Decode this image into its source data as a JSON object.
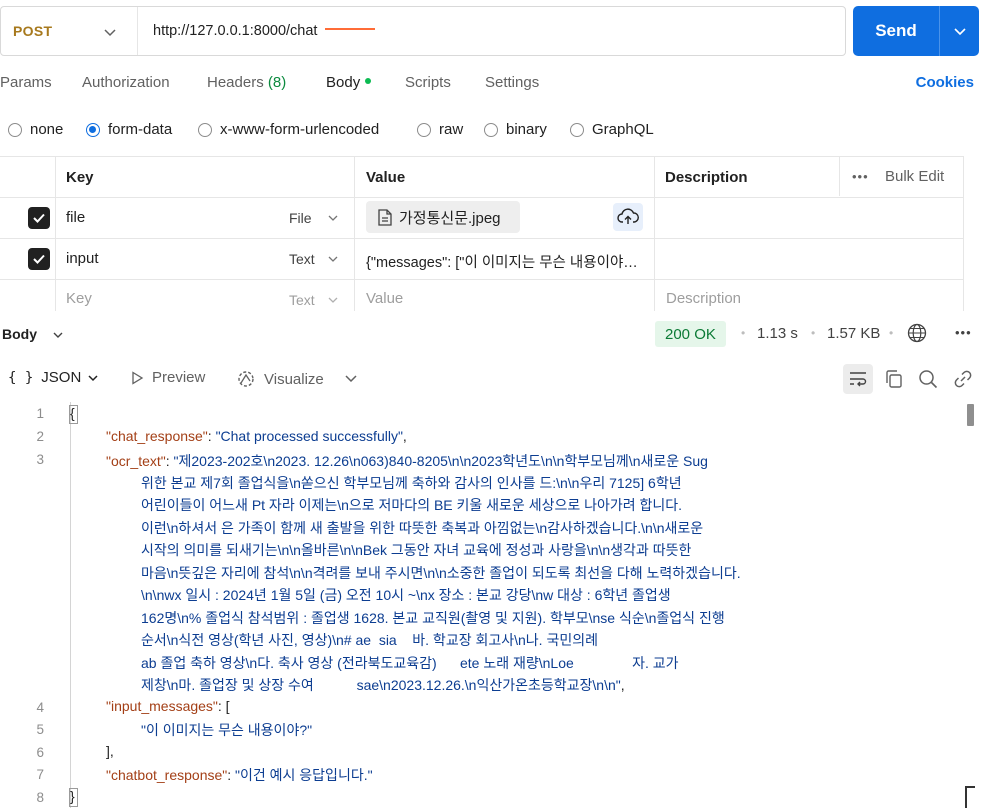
{
  "request": {
    "method": "POST",
    "url": "http://127.0.0.1:8000/chat",
    "send_label": "Send"
  },
  "tabs": {
    "params": "Params",
    "authorization": "Authorization",
    "headers": "Headers",
    "headers_count": "(8)",
    "body": "Body",
    "scripts": "Scripts",
    "settings": "Settings",
    "cookies": "Cookies"
  },
  "body_types": {
    "none": "none",
    "form_data": "form-data",
    "urlencoded": "x-www-form-urlencoded",
    "raw": "raw",
    "binary": "binary",
    "graphql": "GraphQL",
    "selected": "form-data"
  },
  "table": {
    "headers": {
      "key": "Key",
      "value": "Value",
      "description": "Description",
      "bulk_edit": "Bulk Edit"
    },
    "rows": [
      {
        "key": "file",
        "type": "File",
        "value": "가정통신문.jpeg",
        "checked": true
      },
      {
        "key": "input",
        "type": "Text",
        "value": "{\"messages\": [\"이 이미지는 무슨 내용이야?\"]}",
        "checked": true
      }
    ],
    "placeholder": {
      "key": "Key",
      "type": "Text",
      "value": "Value",
      "description": "Description"
    }
  },
  "response": {
    "section_label": "Body",
    "status": "200 OK",
    "time": "1.13 s",
    "size": "1.57 KB",
    "format": "JSON",
    "preview": "Preview",
    "visualize": "Visualize"
  },
  "code": {
    "line_numbers": [
      "1",
      "2",
      "3",
      "4",
      "5",
      "6",
      "7",
      "8"
    ],
    "open_brace": "{",
    "close_brace": "}",
    "chat_response_key": "\"chat_response\"",
    "chat_response_value": "\"Chat processed successfully\"",
    "ocr_text_key": "\"ocr_text\"",
    "ocr_text_lines": [
      "\"제2023-202호\\n2023. 12.26\\n063)840-8205\\n\\n2023학년도\\n\\n학부모님께\\n새로운 Sug",
      "위한 본교 제7회 졸업식을\\n쏟으신 학부모님께 축하와 감사의 인사를 드:\\n\\n우리 7125] 6학년",
      "어린이들이 어느새 Pt 자라 이제는\\n으로 저마다의 BE 키울 새로운 세상으로 나아가려 합니다.",
      "이런\\n하셔서 은 가족이 함께 새 출발을 위한 따뜻한 축복과 아낌없는\\n감사하겠습니다.\\n\\n새로운",
      "시작의 의미를 되새기는\\n\\n올바른\\n\\nBek 그동안 자녀 교육에 정성과 사랑을\\n\\n생각과 따뜻한",
      "마음\\n뜻깊은 자리에 참석\\n\\n격려를 보내 주시면\\n\\n소중한 졸업이 되도록 최선을 다해 노력하겠습니다.",
      "\\n\\nwx 일시 : 2024년 1월 5일 (금) 오전 10시 ~\\nx 장소 : 본교 강당\\nw 대상 : 6학년 졸업생",
      "162명\\n% 졸업식 참석범위 : 졸업생 1628. 본교 교직원(촬영 및 지원). 학부모\\nse 식순\\n졸업식 진행",
      "순서\\n식전 영상(학년 사진, 영상)\\n# ae  sia    바. 학교장 회고사\\n나. 국민의례",
      "ab 졸업 축하 영상\\n다. 축사 영상 (전라북도교육감)      ete 노래 재량\\nLoe               자. 교가",
      "제창\\n마. 졸업장 및 상장 수여           sae\\n2023.12.26.\\n익산가온초등학교장\\n\\n\""
    ],
    "input_messages_key": "\"input_messages\"",
    "input_messages_value": "\"이 이미지는 무슨 내용이야?\"",
    "chatbot_response_key": "\"chatbot_response\"",
    "chatbot_response_value": "\"이건 예시 응답입니다.\""
  }
}
